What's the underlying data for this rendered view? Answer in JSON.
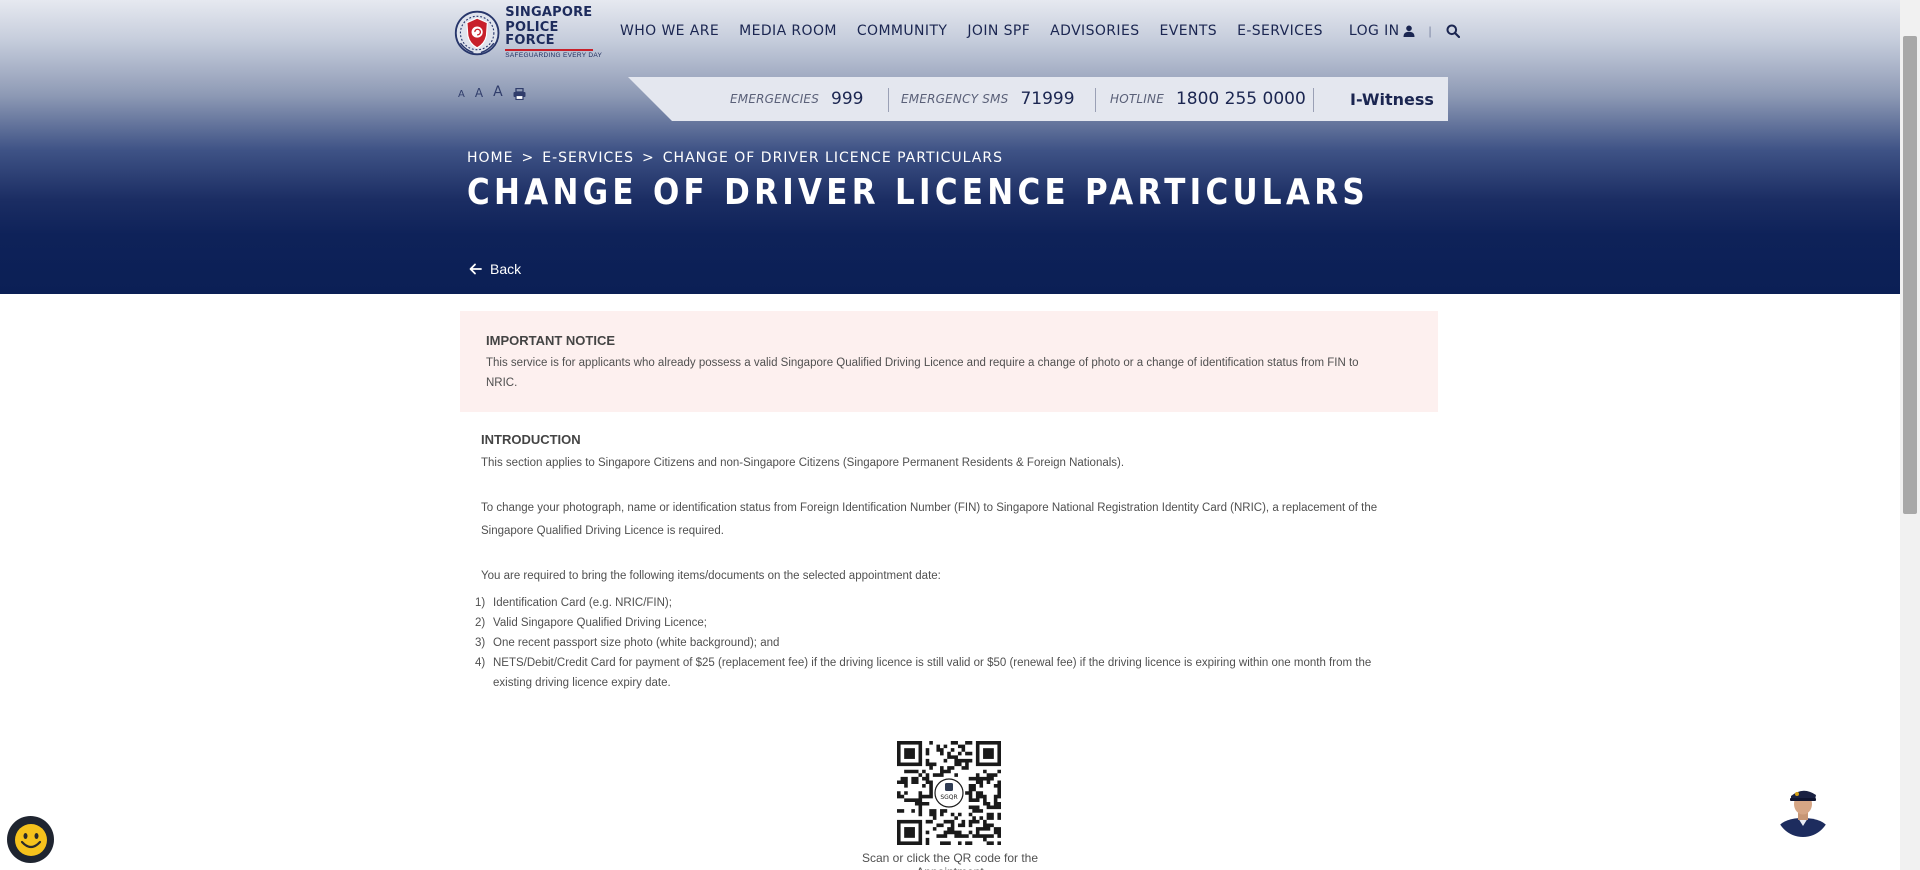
{
  "logo": {
    "line1": "SINGAPORE",
    "line2": "POLICE FORCE",
    "tagline": "SAFEGUARDING EVERY DAY"
  },
  "nav": {
    "items": [
      "WHO WE ARE",
      "MEDIA ROOM",
      "COMMUNITY",
      "JOIN SPF",
      "ADVISORIES",
      "EVENTS",
      "E-SERVICES"
    ],
    "login": "LOG IN",
    "separator": "|"
  },
  "text_size": {
    "small": "A",
    "medium": "A",
    "large": "A"
  },
  "hotlines": {
    "emergencies_label": "EMERGENCIES",
    "emergencies_value": "999",
    "sms_label": "EMERGENCY SMS",
    "sms_value": "71999",
    "hotline_label": "HOTLINE",
    "hotline_value": "1800 255 0000",
    "iwitness": "I-Witness"
  },
  "breadcrumb": {
    "home": "HOME",
    "sep1": ">",
    "eservices": "E-SERVICES",
    "sep2": ">",
    "current": "CHANGE OF DRIVER LICENCE PARTICULARS"
  },
  "page_title": "CHANGE OF DRIVER LICENCE PARTICULARS",
  "back_label": "Back",
  "notice": {
    "title": "IMPORTANT NOTICE",
    "body": "This service is for applicants who already possess a valid Singapore Qualified Driving Licence and require a change of photo or a change of identification status from FIN to NRIC."
  },
  "intro": {
    "title": "INTRODUCTION",
    "p1": "This section applies to Singapore Citizens and non-Singapore Citizens (Singapore Permanent Residents & Foreign Nationals).",
    "p2": "To change your photograph, name or identification status from Foreign Identification Number (FIN) to Singapore National Registration Identity Card (NRIC), a replacement of the Singapore Qualified Driving Licence is required.",
    "p3": "You are required to bring the following items/documents on the selected appointment date:",
    "items": [
      {
        "num": "1)",
        "text": "Identification Card (e.g. NRIC/FIN);"
      },
      {
        "num": "2)",
        "text": "Valid Singapore Qualified Driving Licence;"
      },
      {
        "num": "3)",
        "text": "One recent passport size photo (white background); and"
      },
      {
        "num": "4)",
        "text": "NETS/Debit/Credit Card for payment of $25 (replacement fee) if the driving licence is still valid or $50 (renewal fee) if the driving licence is expiring within one month from the existing driving licence expiry date."
      }
    ]
  },
  "qr": {
    "center_label": "SGQR",
    "caption": "Scan or click the QR code for the Appointment"
  },
  "colors": {
    "navy": "#0b1f55",
    "notice_bg": "#fdf0ef",
    "brand_red": "#c8202a"
  }
}
